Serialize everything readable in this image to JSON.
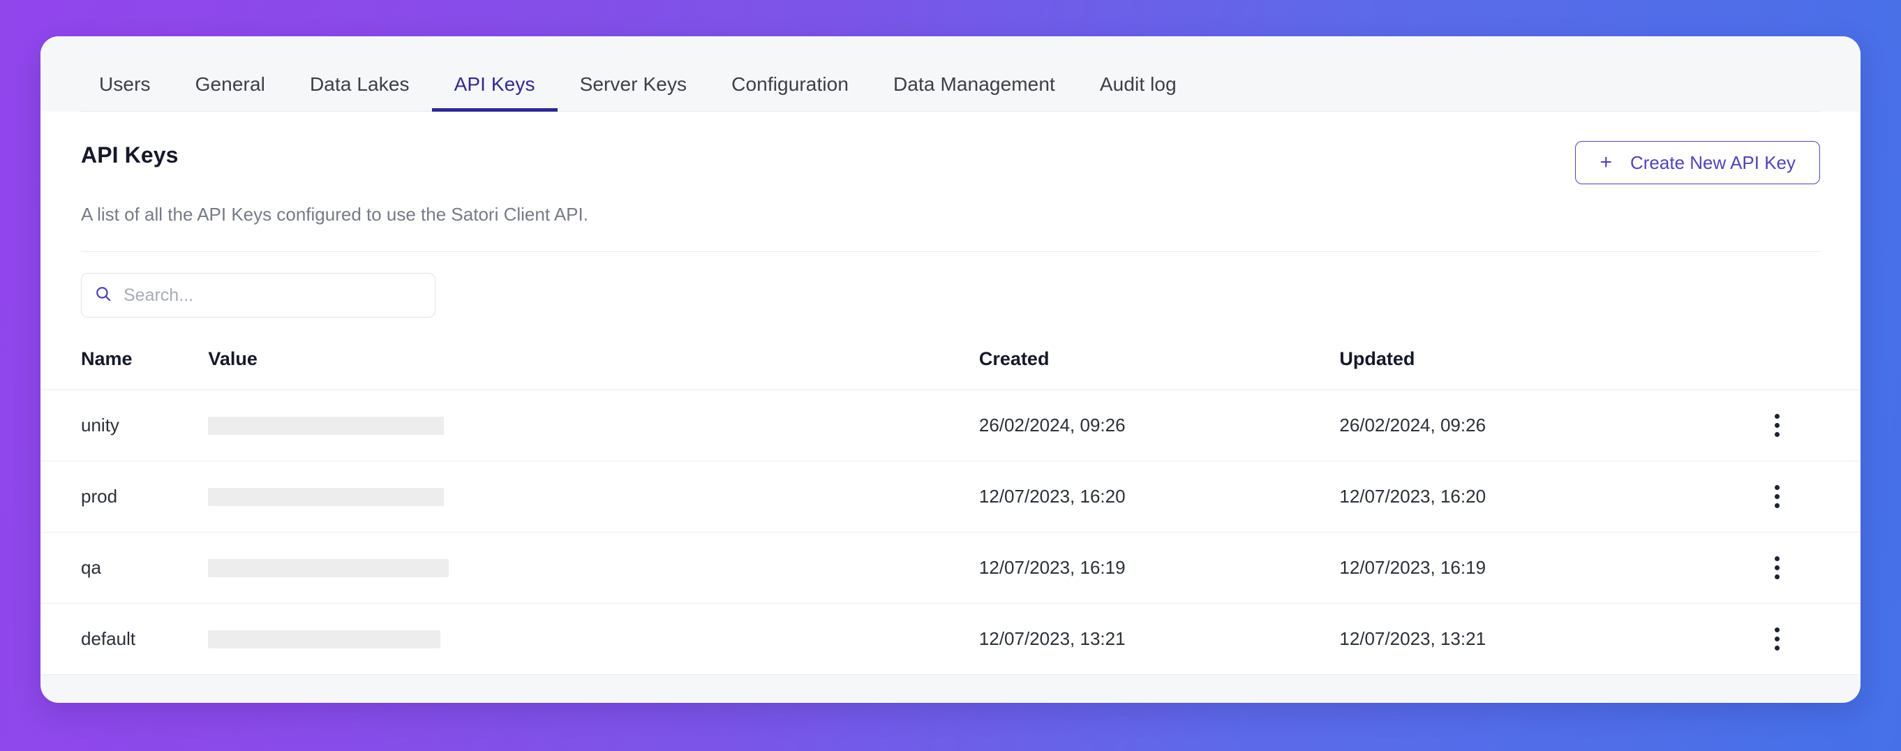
{
  "theme": {
    "bg_gradient_from": "#9146ec",
    "bg_gradient_to": "#4571e8",
    "accent": "#4e45b8",
    "active_tab": "#2f2a8f",
    "card_bg": "#f6f7f9",
    "panel_bg": "#ffffff",
    "masked_bar": "#ededed"
  },
  "tabs": [
    {
      "label": "Users",
      "active": false
    },
    {
      "label": "General",
      "active": false
    },
    {
      "label": "Data Lakes",
      "active": false
    },
    {
      "label": "API Keys",
      "active": true
    },
    {
      "label": "Server Keys",
      "active": false
    },
    {
      "label": "Configuration",
      "active": false
    },
    {
      "label": "Data Management",
      "active": false
    },
    {
      "label": "Audit log",
      "active": false
    }
  ],
  "panel": {
    "title": "API Keys",
    "description": "A list of all the API Keys configured to use the Satori Client API.",
    "create_button": {
      "label": "Create New API Key",
      "icon": "plus-icon",
      "icon_glyph": "+"
    }
  },
  "search": {
    "value": "",
    "placeholder": "Search...",
    "icon": "search-icon"
  },
  "table": {
    "columns": [
      "Name",
      "Value",
      "Created",
      "Updated"
    ],
    "row_action_icon": "kebab-menu-icon",
    "rows": [
      {
        "name": "unity",
        "value_masked": true,
        "value_bar_width": "338px",
        "created": "26/02/2024, 09:26",
        "updated": "26/02/2024, 09:26"
      },
      {
        "name": "prod",
        "value_masked": true,
        "value_bar_width": "338px",
        "created": "12/07/2023, 16:20",
        "updated": "12/07/2023, 16:20"
      },
      {
        "name": "qa",
        "value_masked": true,
        "value_bar_width": "345px",
        "created": "12/07/2023, 16:19",
        "updated": "12/07/2023, 16:19"
      },
      {
        "name": "default",
        "value_masked": true,
        "value_bar_width": "333px",
        "created": "12/07/2023, 13:21",
        "updated": "12/07/2023, 13:21"
      }
    ]
  }
}
